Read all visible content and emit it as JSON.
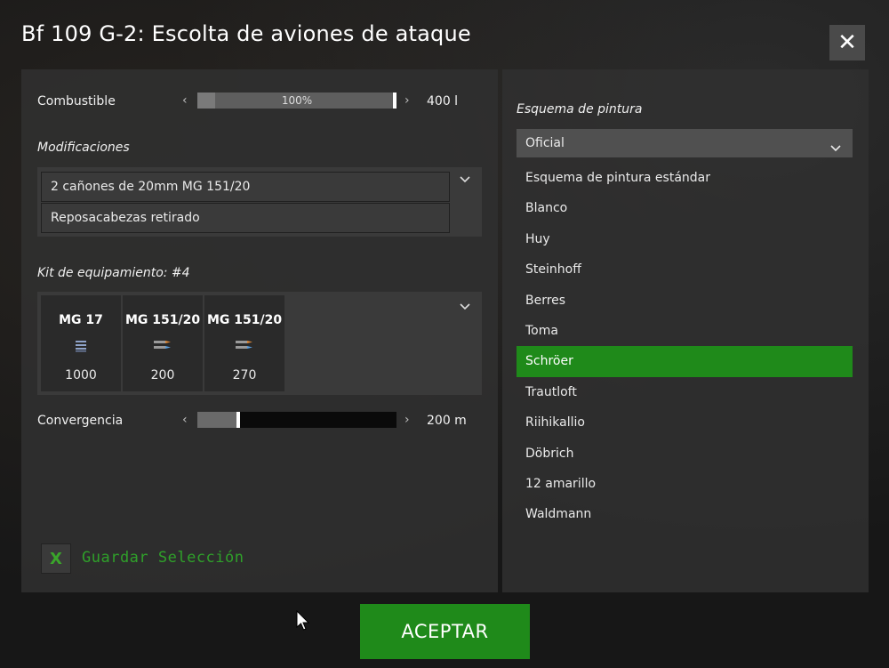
{
  "title": "Bf 109 G-2: Escolta de aviones de ataque",
  "close_label": "✕",
  "fuel": {
    "label": "Combustible",
    "percent_text": "100%",
    "fill_fraction": 1.0,
    "value": "400 l"
  },
  "modifications": {
    "label": "Modificaciones",
    "items": [
      "2 cañones de 20mm MG 151/20",
      "Reposacabezas retirado"
    ]
  },
  "kit": {
    "label": "Kit de equipamiento: #4",
    "weapons": [
      {
        "name": "MG 17",
        "count": "1000",
        "icon": "ammo-belt-icon"
      },
      {
        "name": "MG 151/20",
        "count": "200",
        "icon": "shell-icon"
      },
      {
        "name": "MG 151/20",
        "count": "270",
        "icon": "shell-icon"
      }
    ]
  },
  "convergence": {
    "label": "Convergencia",
    "value": "200 m",
    "fill_fraction": 0.2
  },
  "save_selection": {
    "label": "Guardar Selección",
    "checked": true,
    "mark": "X"
  },
  "paint_scheme": {
    "label": "Esquema de pintura",
    "selected": "Oficial",
    "options": [
      "Esquema de pintura estándar",
      "Blanco",
      "Huy",
      "Steinhoff",
      "Berres",
      "Toma",
      "Schröer",
      "Trautloft",
      "Riihikallio",
      "Döbrich",
      "12 amarillo",
      "Waldmann"
    ],
    "highlighted": "Schröer"
  },
  "accept_label": "ACEPTAR",
  "colors": {
    "accent_green": "#1f8a1a",
    "save_green": "#2fa02a",
    "panel": "#303030"
  }
}
